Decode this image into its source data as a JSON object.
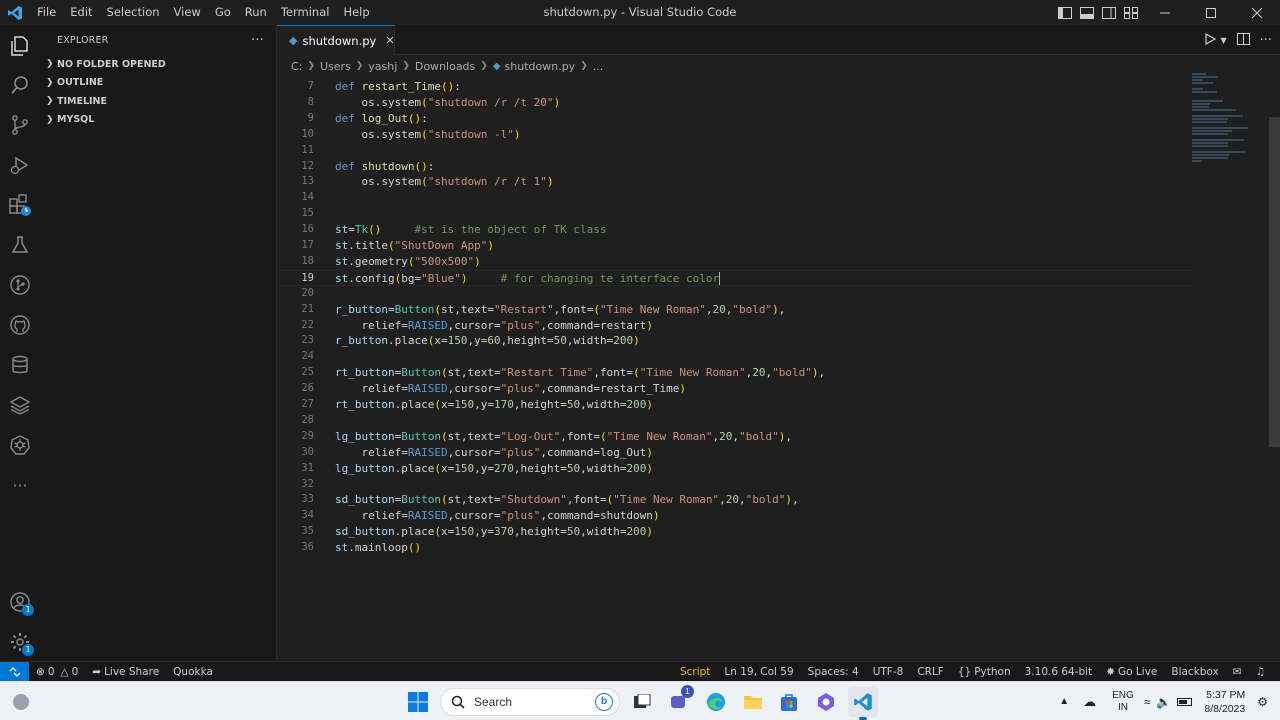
{
  "window": {
    "title": "shutdown.py - Visual Studio Code"
  },
  "menu": [
    "File",
    "Edit",
    "Selection",
    "View",
    "Go",
    "Run",
    "Terminal",
    "Help"
  ],
  "sidebar": {
    "title": "EXPLORER",
    "sections": [
      "NO FOLDER OPENED",
      "OUTLINE",
      "TIMELINE",
      "MYSQL"
    ]
  },
  "activity_badges": {
    "accounts": "1",
    "manage": "1"
  },
  "tab": {
    "label": "shutdown.py"
  },
  "breadcrumb": [
    "C:",
    "Users",
    "yashj",
    "Downloads",
    "shutdown.py",
    "..."
  ],
  "code": {
    "current_line": 19,
    "lines": [
      {
        "n": "7",
        "tokens": [
          [
            "k",
            "def "
          ],
          [
            "f",
            "restart_Time"
          ],
          [
            "p",
            "()"
          ],
          [
            "w",
            ":"
          ]
        ]
      },
      {
        "n": "8",
        "tokens": [
          [
            "w",
            "    os.system"
          ],
          [
            "p",
            "("
          ],
          [
            "s",
            "\"shutdown /r /t 20\""
          ],
          [
            "p",
            ")"
          ]
        ]
      },
      {
        "n": "9",
        "tokens": [
          [
            "k",
            "def "
          ],
          [
            "f",
            "log_Out"
          ],
          [
            "p",
            "()"
          ],
          [
            "w",
            ":"
          ]
        ]
      },
      {
        "n": "10",
        "tokens": [
          [
            "w",
            "    os.system"
          ],
          [
            "p",
            "("
          ],
          [
            "s",
            "\"shutdown -l\""
          ],
          [
            "p",
            ")"
          ]
        ]
      },
      {
        "n": "11",
        "tokens": []
      },
      {
        "n": "12",
        "tokens": [
          [
            "k",
            "def "
          ],
          [
            "f",
            "shutdown"
          ],
          [
            "p",
            "()"
          ],
          [
            "w",
            ":"
          ]
        ]
      },
      {
        "n": "13",
        "tokens": [
          [
            "w",
            "    os.system"
          ],
          [
            "p",
            "("
          ],
          [
            "s",
            "\"shutdown /r /t 1\""
          ],
          [
            "p",
            ")"
          ]
        ]
      },
      {
        "n": "14",
        "tokens": []
      },
      {
        "n": "15",
        "tokens": []
      },
      {
        "n": "16",
        "tokens": [
          [
            "v",
            "st"
          ],
          [
            "w",
            "="
          ],
          [
            "t",
            "Tk"
          ],
          [
            "p",
            "()"
          ],
          [
            "c",
            "     #st is the object of TK class"
          ]
        ]
      },
      {
        "n": "17",
        "tokens": [
          [
            "v",
            "st"
          ],
          [
            "w",
            ".title"
          ],
          [
            "p",
            "("
          ],
          [
            "s",
            "\"ShutDown App\""
          ],
          [
            "p",
            ")"
          ]
        ]
      },
      {
        "n": "18",
        "tokens": [
          [
            "v",
            "st"
          ],
          [
            "w",
            ".geometry"
          ],
          [
            "p",
            "("
          ],
          [
            "s",
            "\"500x500\""
          ],
          [
            "p",
            ")"
          ]
        ]
      },
      {
        "n": "19",
        "tokens": [
          [
            "v",
            "st"
          ],
          [
            "w",
            ".config"
          ],
          [
            "p",
            "("
          ],
          [
            "w",
            "bg="
          ],
          [
            "s",
            "\"Blue\""
          ],
          [
            "p",
            ")"
          ],
          [
            "c",
            "     # for changing te interface color"
          ]
        ]
      },
      {
        "n": "20",
        "tokens": []
      },
      {
        "n": "21",
        "tokens": [
          [
            "v",
            "r_button"
          ],
          [
            "w",
            "="
          ],
          [
            "t",
            "Button"
          ],
          [
            "p",
            "("
          ],
          [
            "w",
            "st,text="
          ],
          [
            "s",
            "\"Restart\""
          ],
          [
            "w",
            ",font="
          ],
          [
            "p",
            "("
          ],
          [
            "s",
            "\"Time New Roman\""
          ],
          [
            "w",
            ","
          ],
          [
            "n",
            "20"
          ],
          [
            "w",
            ","
          ],
          [
            "s",
            "\"bold\""
          ],
          [
            "p",
            ")"
          ],
          [
            "w",
            ","
          ]
        ]
      },
      {
        "n": "22",
        "tokens": [
          [
            "w",
            "    relief="
          ],
          [
            "k",
            "RAISED"
          ],
          [
            "w",
            ",cursor="
          ],
          [
            "s",
            "\"plus\""
          ],
          [
            "w",
            ",command=restart"
          ],
          [
            "p",
            ")"
          ]
        ]
      },
      {
        "n": "23",
        "tokens": [
          [
            "v",
            "r_button"
          ],
          [
            "w",
            ".place"
          ],
          [
            "p",
            "("
          ],
          [
            "w",
            "x="
          ],
          [
            "n",
            "150"
          ],
          [
            "w",
            ",y="
          ],
          [
            "n",
            "60"
          ],
          [
            "w",
            ",height="
          ],
          [
            "n",
            "50"
          ],
          [
            "w",
            ",width="
          ],
          [
            "n",
            "200"
          ],
          [
            "p",
            ")"
          ]
        ]
      },
      {
        "n": "24",
        "tokens": []
      },
      {
        "n": "25",
        "tokens": [
          [
            "v",
            "rt_button"
          ],
          [
            "w",
            "="
          ],
          [
            "t",
            "Button"
          ],
          [
            "p",
            "("
          ],
          [
            "w",
            "st,text="
          ],
          [
            "s",
            "\"Restart Time\""
          ],
          [
            "w",
            ",font="
          ],
          [
            "p",
            "("
          ],
          [
            "s",
            "\"Time New Roman\""
          ],
          [
            "w",
            ","
          ],
          [
            "n",
            "20"
          ],
          [
            "w",
            ","
          ],
          [
            "s",
            "\"bold\""
          ],
          [
            "p",
            ")"
          ],
          [
            "w",
            ","
          ]
        ]
      },
      {
        "n": "26",
        "tokens": [
          [
            "w",
            "    relief="
          ],
          [
            "k",
            "RAISED"
          ],
          [
            "w",
            ",cursor="
          ],
          [
            "s",
            "\"plus\""
          ],
          [
            "w",
            ",command=restart_Time"
          ],
          [
            "p",
            ")"
          ]
        ]
      },
      {
        "n": "27",
        "tokens": [
          [
            "v",
            "rt_button"
          ],
          [
            "w",
            ".place"
          ],
          [
            "p",
            "("
          ],
          [
            "w",
            "x="
          ],
          [
            "n",
            "150"
          ],
          [
            "w",
            ",y="
          ],
          [
            "n",
            "170"
          ],
          [
            "w",
            ",height="
          ],
          [
            "n",
            "50"
          ],
          [
            "w",
            ",width="
          ],
          [
            "n",
            "200"
          ],
          [
            "p",
            ")"
          ]
        ]
      },
      {
        "n": "28",
        "tokens": []
      },
      {
        "n": "29",
        "tokens": [
          [
            "v",
            "lg_button"
          ],
          [
            "w",
            "="
          ],
          [
            "t",
            "Button"
          ],
          [
            "p",
            "("
          ],
          [
            "w",
            "st,text="
          ],
          [
            "s",
            "\"Log-Out\""
          ],
          [
            "w",
            ",font="
          ],
          [
            "p",
            "("
          ],
          [
            "s",
            "\"Time New Roman\""
          ],
          [
            "w",
            ","
          ],
          [
            "n",
            "20"
          ],
          [
            "w",
            ","
          ],
          [
            "s",
            "\"bold\""
          ],
          [
            "p",
            ")"
          ],
          [
            "w",
            ","
          ]
        ]
      },
      {
        "n": "30",
        "tokens": [
          [
            "w",
            "    relief="
          ],
          [
            "k",
            "RAISED"
          ],
          [
            "w",
            ",cursor="
          ],
          [
            "s",
            "\"plus\""
          ],
          [
            "w",
            ",command=log_Out"
          ],
          [
            "p",
            ")"
          ]
        ]
      },
      {
        "n": "31",
        "tokens": [
          [
            "v",
            "lg_button"
          ],
          [
            "w",
            ".place"
          ],
          [
            "p",
            "("
          ],
          [
            "w",
            "x="
          ],
          [
            "n",
            "150"
          ],
          [
            "w",
            ",y="
          ],
          [
            "n",
            "270"
          ],
          [
            "w",
            ",height="
          ],
          [
            "n",
            "50"
          ],
          [
            "w",
            ",width="
          ],
          [
            "n",
            "200"
          ],
          [
            "p",
            ")"
          ]
        ]
      },
      {
        "n": "32",
        "tokens": []
      },
      {
        "n": "33",
        "tokens": [
          [
            "v",
            "sd_button"
          ],
          [
            "w",
            "="
          ],
          [
            "t",
            "Button"
          ],
          [
            "p",
            "("
          ],
          [
            "w",
            "st,text="
          ],
          [
            "s",
            "\"Shutdown\""
          ],
          [
            "w",
            ",font="
          ],
          [
            "p",
            "("
          ],
          [
            "s",
            "\"Time New Roman\""
          ],
          [
            "w",
            ","
          ],
          [
            "n",
            "20"
          ],
          [
            "w",
            ","
          ],
          [
            "s",
            "\"bold\""
          ],
          [
            "p",
            ")"
          ],
          [
            "w",
            ","
          ]
        ]
      },
      {
        "n": "34",
        "tokens": [
          [
            "w",
            "    relief="
          ],
          [
            "k",
            "RAISED"
          ],
          [
            "w",
            ",cursor="
          ],
          [
            "s",
            "\"plus\""
          ],
          [
            "w",
            ",command=shutdown"
          ],
          [
            "p",
            ")"
          ]
        ]
      },
      {
        "n": "35",
        "tokens": [
          [
            "v",
            "sd_button"
          ],
          [
            "w",
            ".place"
          ],
          [
            "p",
            "("
          ],
          [
            "w",
            "x="
          ],
          [
            "n",
            "150"
          ],
          [
            "w",
            ",y="
          ],
          [
            "n",
            "370"
          ],
          [
            "w",
            ",height="
          ],
          [
            "n",
            "50"
          ],
          [
            "w",
            ",width="
          ],
          [
            "n",
            "200"
          ],
          [
            "p",
            ")"
          ]
        ]
      },
      {
        "n": "36",
        "tokens": [
          [
            "v",
            "st"
          ],
          [
            "w",
            ".mainloop"
          ],
          [
            "p",
            "()"
          ]
        ]
      }
    ]
  },
  "statusbar": {
    "problems_errors": "0",
    "problems_warnings": "0",
    "live_share": "Live Share",
    "quokka": "Quokka",
    "mode": "Script",
    "position": "Ln 19, Col 59",
    "spaces": "Spaces: 4",
    "encoding": "UTF-8",
    "eol": "CRLF",
    "language": "Python",
    "interpreter": "3.10.6 64-bit",
    "go_live": "Go Live",
    "blackbox": "Blackbox"
  },
  "taskbar": {
    "search_placeholder": "Search",
    "chat_badge": "1",
    "lang_1": "ENG",
    "lang_2": "IN",
    "time": "5:37 PM",
    "date": "8/8/2023"
  },
  "colors": {
    "accent": "#0078d4",
    "editor_bg": "#1f1f1f",
    "sidebar_bg": "#181818"
  }
}
